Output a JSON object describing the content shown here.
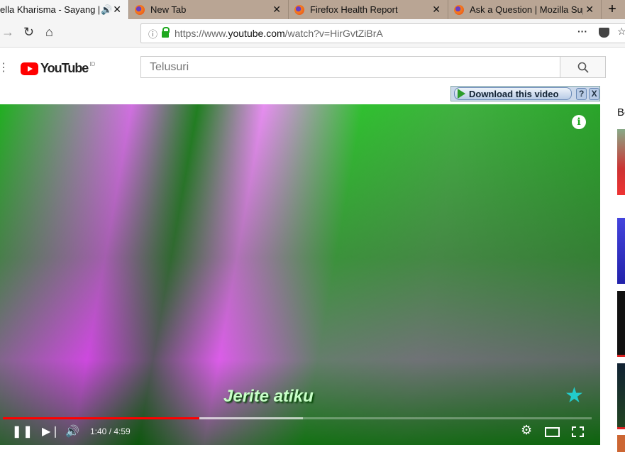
{
  "tabs": [
    {
      "title": "ella Kharisma - Sayang [off",
      "active": true,
      "audio": true
    },
    {
      "title": "New Tab"
    },
    {
      "title": "Firefox Health Report"
    },
    {
      "title": "Ask a Question | Mozilla Suppor"
    }
  ],
  "address": {
    "prefix": "https://www.",
    "domain": "youtube.com",
    "path": "/watch?v=HirGvtZiBrA"
  },
  "youtube": {
    "logo": "YouTube",
    "region": "ID",
    "search_placeholder": "Telusuri"
  },
  "download": {
    "label": "Download this video",
    "help": "?",
    "close": "X"
  },
  "player": {
    "lyric": "Jerite atiku",
    "current": "1:40",
    "duration": "4:59",
    "time_text": "1:40 / 4:59",
    "progress": 0.334,
    "info": "i"
  },
  "sidebar": {
    "heading": "Be"
  },
  "colors": {
    "accent": "#ff0000"
  }
}
